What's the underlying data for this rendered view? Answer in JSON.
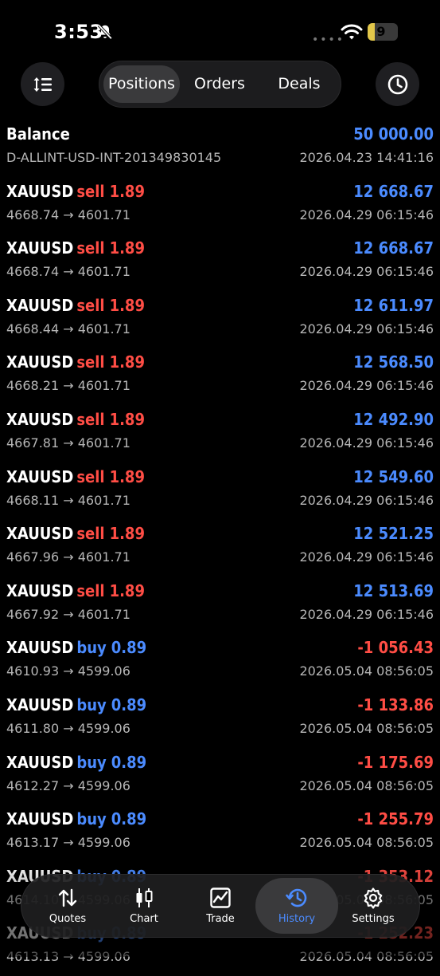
{
  "status_bar": {
    "time": "3:53",
    "battery": "9",
    "colors": {
      "battery": "#e2c74a"
    }
  },
  "toolbar": {
    "tabs": [
      "Positions",
      "Orders",
      "Deals"
    ],
    "active_tab": "Positions",
    "left_icon": "sort-icon",
    "right_icon": "clock-icon"
  },
  "balance": {
    "label": "Balance",
    "amount": "50 000.00",
    "account": "D-ALLINT-USD-INT-201349830145",
    "datetime": "2026.04.23 14:41:16"
  },
  "deals": [
    {
      "symbol": "XAUUSD",
      "side": "sell",
      "volume": "1.89",
      "prices": "4668.74 → 4601.71",
      "profit": "12 668.67",
      "datetime": "2026.04.29 06:15:46"
    },
    {
      "symbol": "XAUUSD",
      "side": "sell",
      "volume": "1.89",
      "prices": "4668.74 → 4601.71",
      "profit": "12 668.67",
      "datetime": "2026.04.29 06:15:46"
    },
    {
      "symbol": "XAUUSD",
      "side": "sell",
      "volume": "1.89",
      "prices": "4668.44 → 4601.71",
      "profit": "12 611.97",
      "datetime": "2026.04.29 06:15:46"
    },
    {
      "symbol": "XAUUSD",
      "side": "sell",
      "volume": "1.89",
      "prices": "4668.21 → 4601.71",
      "profit": "12 568.50",
      "datetime": "2026.04.29 06:15:46"
    },
    {
      "symbol": "XAUUSD",
      "side": "sell",
      "volume": "1.89",
      "prices": "4667.81 → 4601.71",
      "profit": "12 492.90",
      "datetime": "2026.04.29 06:15:46"
    },
    {
      "symbol": "XAUUSD",
      "side": "sell",
      "volume": "1.89",
      "prices": "4668.11 → 4601.71",
      "profit": "12 549.60",
      "datetime": "2026.04.29 06:15:46"
    },
    {
      "symbol": "XAUUSD",
      "side": "sell",
      "volume": "1.89",
      "prices": "4667.96 → 4601.71",
      "profit": "12 521.25",
      "datetime": "2026.04.29 06:15:46"
    },
    {
      "symbol": "XAUUSD",
      "side": "sell",
      "volume": "1.89",
      "prices": "4667.92 → 4601.71",
      "profit": "12 513.69",
      "datetime": "2026.04.29 06:15:46"
    },
    {
      "symbol": "XAUUSD",
      "side": "buy",
      "volume": "0.89",
      "prices": "4610.93 → 4599.06",
      "profit": "-1 056.43",
      "datetime": "2026.05.04 08:56:05"
    },
    {
      "symbol": "XAUUSD",
      "side": "buy",
      "volume": "0.89",
      "prices": "4611.80 → 4599.06",
      "profit": "-1 133.86",
      "datetime": "2026.05.04 08:56:05"
    },
    {
      "symbol": "XAUUSD",
      "side": "buy",
      "volume": "0.89",
      "prices": "4612.27 → 4599.06",
      "profit": "-1 175.69",
      "datetime": "2026.05.04 08:56:05"
    },
    {
      "symbol": "XAUUSD",
      "side": "buy",
      "volume": "0.89",
      "prices": "4613.17 → 4599.06",
      "profit": "-1 255.79",
      "datetime": "2026.05.04 08:56:05"
    },
    {
      "symbol": "XAUUSD",
      "side": "buy",
      "volume": "0.89",
      "prices": "4614.10 → 4599.06",
      "profit": "-1 353.12",
      "datetime": "2026.05.04 08:56:05"
    },
    {
      "symbol": "XAUUSD",
      "side": "buy",
      "volume": "0.89",
      "prices": "4613.13 → 4599.06",
      "profit": "-1 252.23",
      "datetime": "2026.05.04 08:56:05"
    }
  ],
  "tabbar": {
    "items": [
      {
        "label": "Quotes",
        "icon": "quotes-icon"
      },
      {
        "label": "Chart",
        "icon": "chart-icon"
      },
      {
        "label": "Trade",
        "icon": "trade-icon"
      },
      {
        "label": "History",
        "icon": "history-icon"
      },
      {
        "label": "Settings",
        "icon": "gear-icon"
      }
    ],
    "active": "History"
  },
  "colors": {
    "profit": "#4b8bff",
    "loss": "#ff4d45",
    "buy": "#4b8bff",
    "sell": "#ff4d45"
  }
}
